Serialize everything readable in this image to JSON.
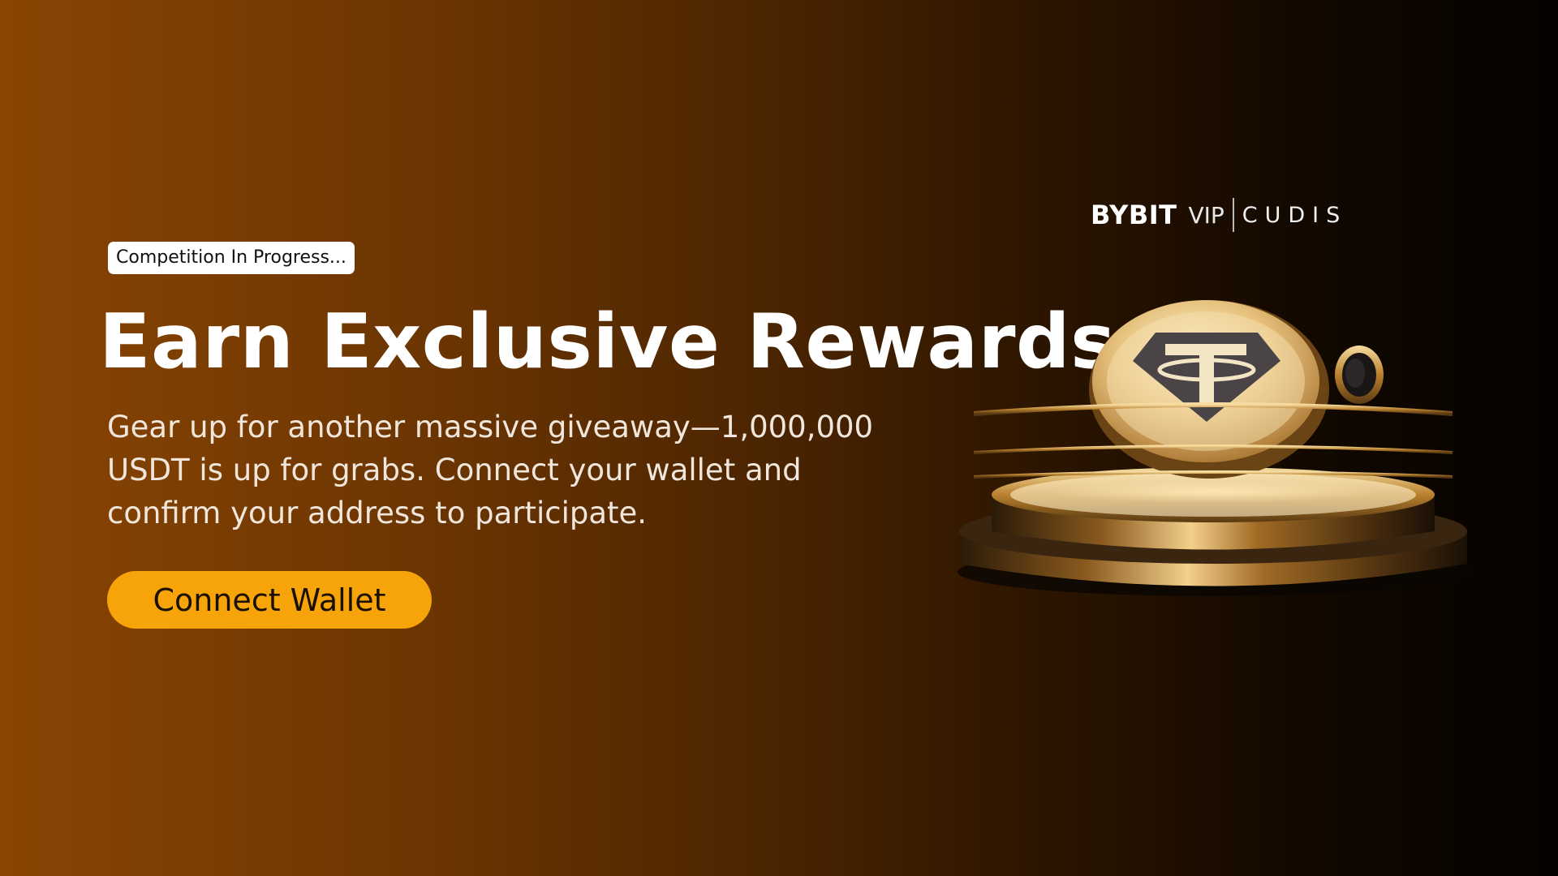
{
  "badge": {
    "text": "Competition In Progress..."
  },
  "hero": {
    "title": "Earn Exclusive Rewards",
    "description": "Gear up for another massive giveaway—1,000,000 USDT is up for grabs. Connect your wallet and confirm your address to participate."
  },
  "cta": {
    "label": "Connect Wallet"
  },
  "brand": {
    "bybit": "BYBIT",
    "vip": "VIP",
    "cudis": "CUDIS"
  },
  "illustration": {
    "coin_icon": "tether-coin-icon",
    "ring_icon": "smart-ring-icon"
  },
  "colors": {
    "background_start": "#8a4503",
    "background_end": "#050200",
    "button": "#f7a40a",
    "badge": "#ffffff"
  }
}
